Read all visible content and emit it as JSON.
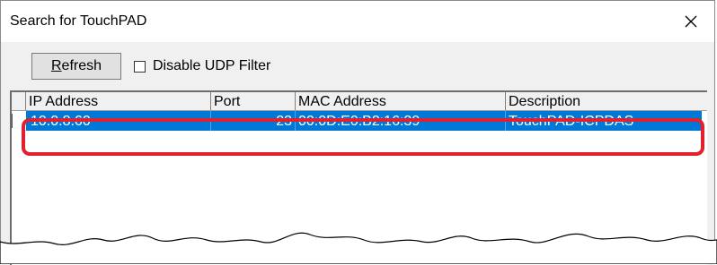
{
  "window": {
    "title": "Search for TouchPAD"
  },
  "toolbar": {
    "refresh_label_underlined": "R",
    "refresh_label_rest": "efresh",
    "disable_udp_filter_label": "Disable UDP Filter",
    "disable_udp_filter_checked": false
  },
  "table": {
    "columns": [
      "IP Address",
      "Port",
      "MAC Address",
      "Description"
    ],
    "rows": [
      {
        "ip": "10.0.8.60",
        "port": "23",
        "mac": "00:0D:E0:B2:16:39",
        "description": "TouchPAD-ICPDAS",
        "selected": true
      }
    ]
  },
  "colors": {
    "selection": "#0078d7",
    "highlight": "#e3202d"
  }
}
